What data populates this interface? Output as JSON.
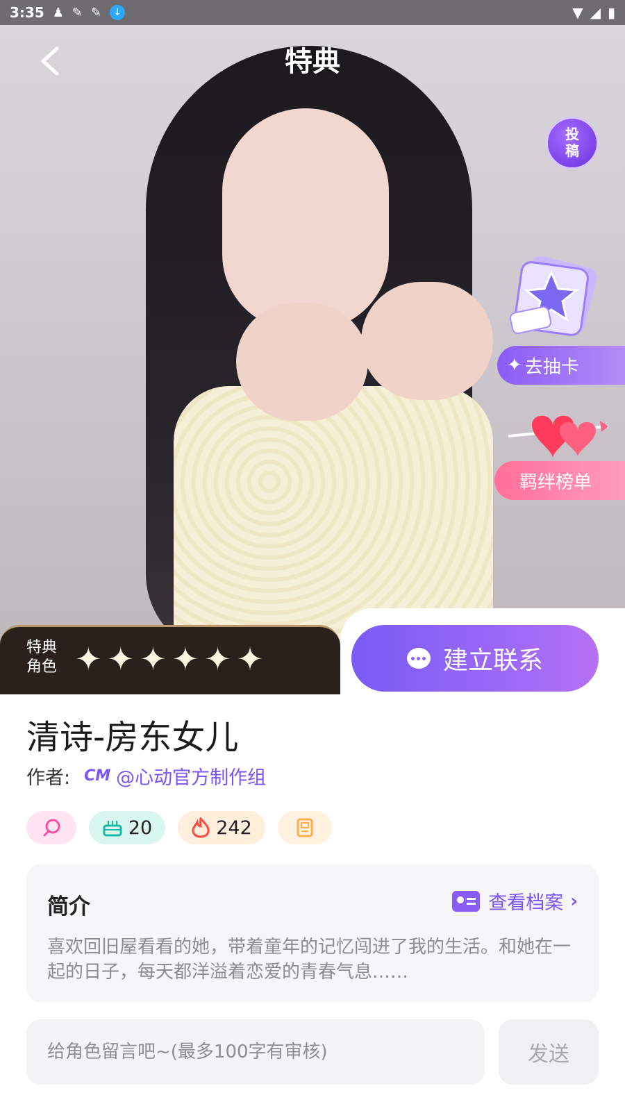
{
  "status_bar": {
    "time": "3:35"
  },
  "header": {
    "title": "特典"
  },
  "hero": {
    "submit_badge": "投\n稿",
    "submit_badge_top": "投",
    "submit_badge_bottom": "稿",
    "draw_card_label": "去抽卡",
    "bond_rank_label": "羁绊榜单"
  },
  "rating": {
    "label_line1": "特典",
    "label_line2": "角色",
    "star_count": 6
  },
  "connect_button": {
    "label": "建立联系"
  },
  "character": {
    "name": "清诗-房东女儿",
    "author_label": "作者:",
    "author_name": "@心动官方制作组",
    "author_logo": "CM"
  },
  "tags": [
    {
      "icon": "chat-heart-icon",
      "value": ""
    },
    {
      "icon": "cake-icon",
      "value": "20"
    },
    {
      "icon": "flame-icon",
      "value": "242"
    },
    {
      "icon": "device-icon",
      "value": ""
    }
  ],
  "intro": {
    "title": "简介",
    "view_file_label": "查看档案",
    "text": "喜欢回旧屋看看的她，带着童年的记忆闯进了我的生活。和她在一起的日子，每天都洋溢着恋爱的青春气息……"
  },
  "message": {
    "placeholder": "给角色留言吧~(最多100字有审核)",
    "value": "",
    "send_label": "发送"
  },
  "colors": {
    "accent_purple": "#7a55f5",
    "bond_pink": "#ff6f9a",
    "rating_dark": "#2a211c"
  }
}
